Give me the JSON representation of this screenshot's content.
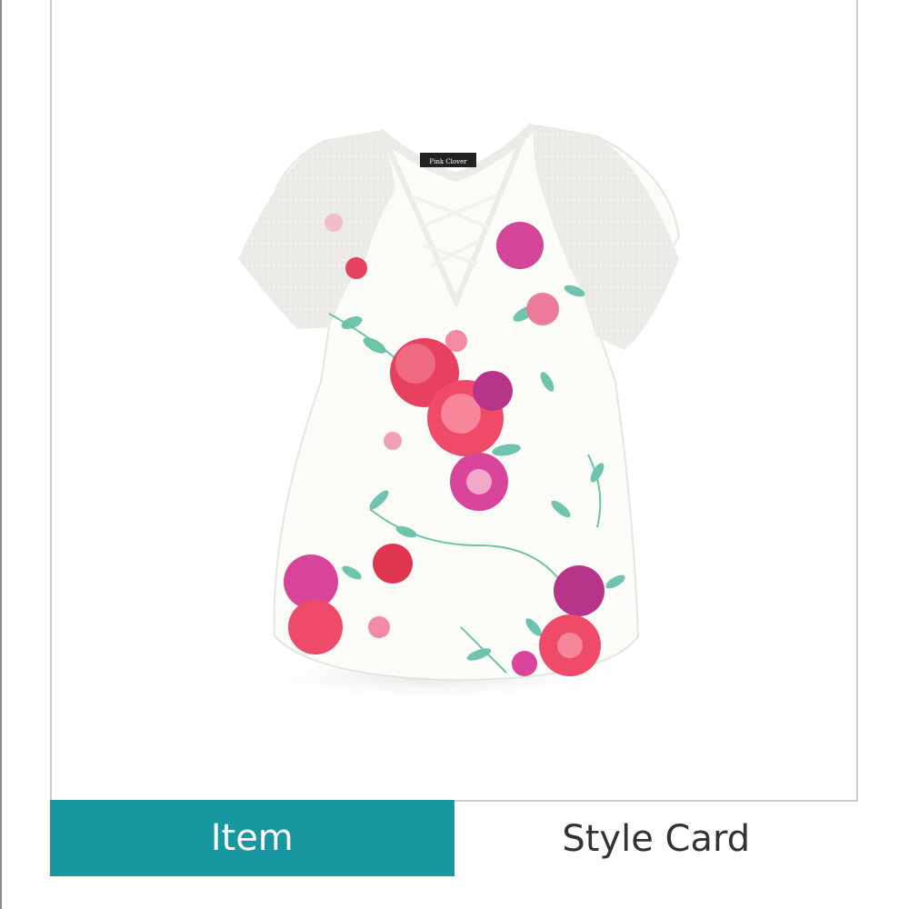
{
  "product": {
    "image_alt": "Floral print short-sleeve top with criss-cross V-neck",
    "brand_tag": "Pink Clover"
  },
  "tabs": [
    {
      "label": "Item",
      "active": true
    },
    {
      "label": "Style Card",
      "active": false
    }
  ],
  "colors": {
    "accent": "#1997a1",
    "inactive_text": "#333333",
    "border": "#cfcfcf"
  }
}
